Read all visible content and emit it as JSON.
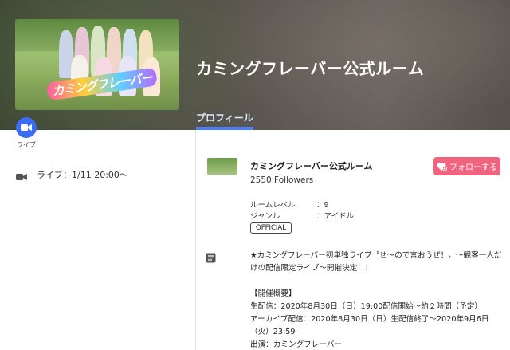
{
  "header": {
    "room_title": "カミングフレーバー公式ルーム",
    "tab_profile": "プロフィール",
    "thumb_logo": "カミングフレーバー"
  },
  "live": {
    "label": "ライブ",
    "schedule": "ライブ：1/11 20:00〜",
    "icon": "video-camera-icon"
  },
  "profile": {
    "name": "カミングフレーバー公式ルーム",
    "followers": "2550 Followers",
    "follow_button": "フォローする",
    "room_level_label": "ルームレベル",
    "room_level_value": "：9",
    "genre_label": "ジャンル",
    "genre_value": "：アイドル",
    "badge": "OFFICIAL"
  },
  "description": {
    "line1": "★カミングフレーバー初単独ライブ〝せ〜ので言おうぜ！〟〜観客一人だけの配信限定ライブ〜開催決定！！",
    "heading": "【開催概要】",
    "line2": "生配信：2020年8月30日（日）19:00配信開始〜約２時間（予定）",
    "line3": "アーカイブ配信：2020年8月30日（日）生配信終了〜2020年9月6日（火）23:59",
    "line4": "出演：カミングフレーバー"
  },
  "colors": {
    "accent_blue": "#3a6cf4",
    "follow_pink": "#f0647f",
    "tab_underline": "#4a7dff"
  }
}
